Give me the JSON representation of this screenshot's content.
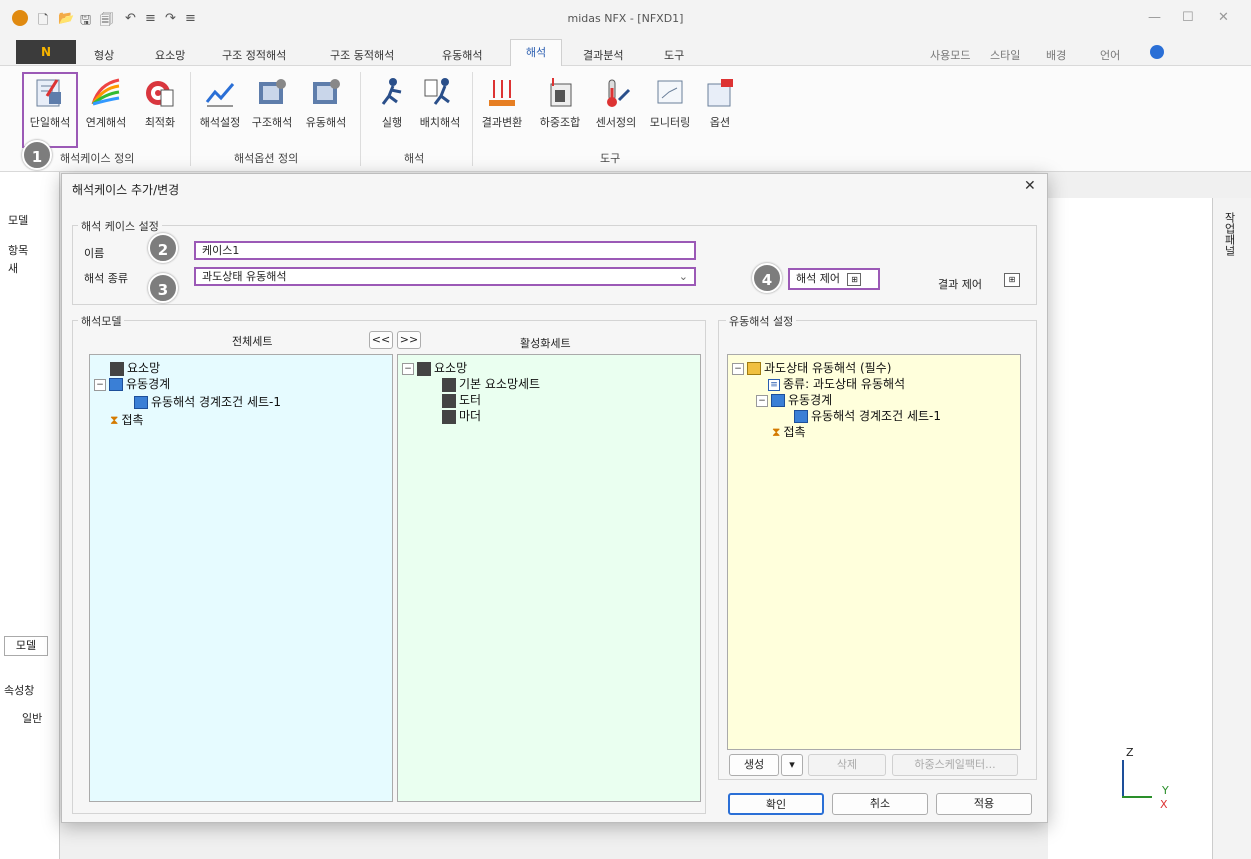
{
  "app": {
    "title": "midas NFX - [NFXD1]"
  },
  "menu": {
    "app_button": "N",
    "tabs": [
      "형상",
      "요소망",
      "구조 정적해석",
      "구조 동적해석",
      "유동해석",
      "해석",
      "결과분석",
      "도구"
    ],
    "active_tab": "해석",
    "right_items": [
      "사용모드",
      "스타일",
      "배경",
      "언어"
    ]
  },
  "ribbon": {
    "buttons": [
      "단일해석",
      "연계해석",
      "최적화",
      "해석설정",
      "구조해석",
      "유동해석",
      "실행",
      "배치해석",
      "결과변환",
      "하중조합",
      "센서정의",
      "모니터링",
      "옵션"
    ],
    "groups": [
      "해석케이스 정의",
      "해석옵션 정의",
      "해석",
      "도구"
    ]
  },
  "left_pane": {
    "labels": [
      "모델",
      "항목",
      "새",
      "모델",
      "속성창",
      "일반"
    ]
  },
  "right_strip": {
    "label": "작업패널"
  },
  "dialog": {
    "title": "해석케이스 추가/변경",
    "case_settings": "해석 케이스 설정",
    "name_label": "이름",
    "name_value": "케이스1",
    "type_label": "해석 종류",
    "type_value": "과도상태 유동해석",
    "analysis_control": "해석 제어",
    "result_control": "결과 제어",
    "model_group": "해석모델",
    "all_sets": "전체세트",
    "active_sets": "활성화세트",
    "move_left": "<<",
    "move_right": ">>",
    "all_tree": [
      "요소망",
      "유동경계",
      "유동해석 경계조건 세트-1",
      "접촉"
    ],
    "active_tree": [
      "요소망",
      "기본 요소망세트",
      "도터",
      "마더"
    ],
    "flow_group": "유동해석 설정",
    "flow_tree": [
      "과도상태 유동해석 (필수)",
      "종류: 과도상태 유동해석",
      "유동경계",
      "유동해석 경계조건 세트-1",
      "접촉"
    ],
    "create": "생성",
    "delete": "삭제",
    "load_scale": "하중스케일팩터...",
    "ok": "확인",
    "cancel": "취소",
    "apply": "적용"
  },
  "badges": [
    "1",
    "2",
    "3",
    "4"
  ],
  "axes": {
    "z": "Z",
    "y": "Y",
    "x": "X"
  },
  "colors": {
    "highlight": "#9b59b6",
    "badge": "#7d7d7d",
    "all_bg": "#e6fbff",
    "active_bg": "#eafff0",
    "flow_bg": "#ffffdc"
  }
}
